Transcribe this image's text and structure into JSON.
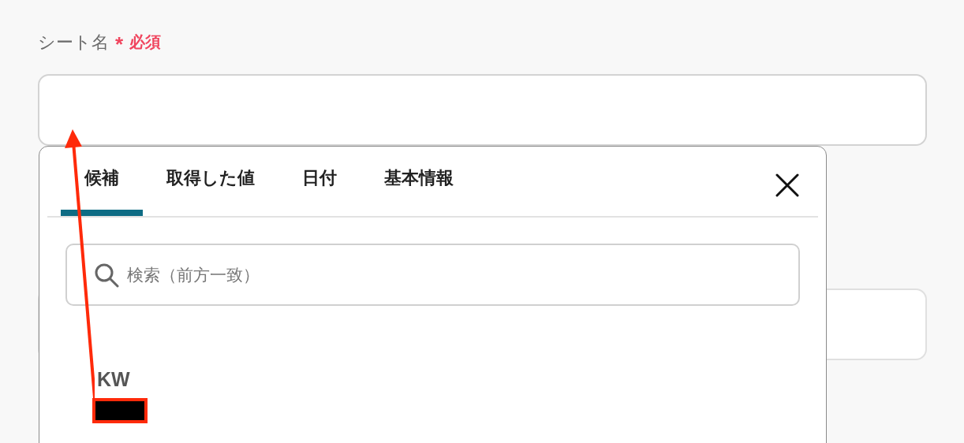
{
  "field": {
    "label": "シート名",
    "required_mark": "*",
    "required_text": "必須"
  },
  "popup": {
    "tabs": [
      {
        "label": "候補",
        "selected": true
      },
      {
        "label": "取得した値",
        "selected": false
      },
      {
        "label": "日付",
        "selected": false
      },
      {
        "label": "基本情報",
        "selected": false
      }
    ],
    "search": {
      "placeholder": "検索（前方一致）"
    },
    "items": [
      {
        "label": "KW"
      }
    ]
  }
}
